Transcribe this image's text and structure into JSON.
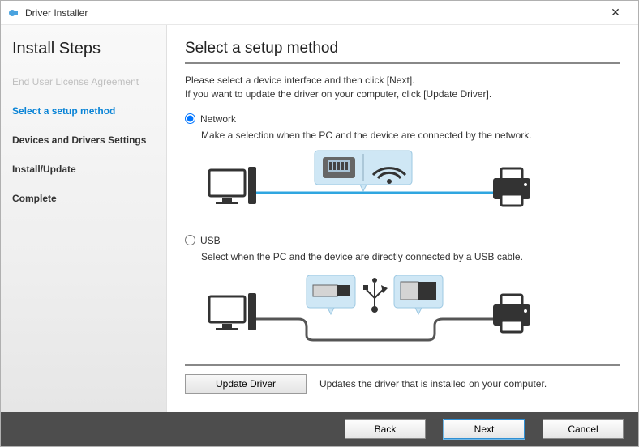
{
  "window": {
    "title": "Driver Installer"
  },
  "sidebar": {
    "heading": "Install Steps",
    "steps": [
      {
        "label": "End User License Agreement",
        "state": "disabled"
      },
      {
        "label": "Select a setup method",
        "state": "current"
      },
      {
        "label": "Devices and Drivers Settings",
        "state": "bold"
      },
      {
        "label": "Install/Update",
        "state": "bold"
      },
      {
        "label": "Complete",
        "state": "bold"
      }
    ]
  },
  "main": {
    "heading": "Select a setup method",
    "instruction_line1": "Please select a device interface and then click [Next].",
    "instruction_line2": "If you want to update the driver on your computer, click [Update Driver].",
    "options": {
      "network": {
        "label": "Network",
        "desc": "Make a selection when the PC and the device are connected by the network.",
        "selected": true
      },
      "usb": {
        "label": "USB",
        "desc": "Select when the PC and the device are directly connected by a USB cable.",
        "selected": false
      }
    },
    "update": {
      "button": "Update Driver",
      "desc": "Updates the driver that is installed on your computer."
    }
  },
  "footer": {
    "back": "Back",
    "next": "Next",
    "cancel": "Cancel"
  }
}
